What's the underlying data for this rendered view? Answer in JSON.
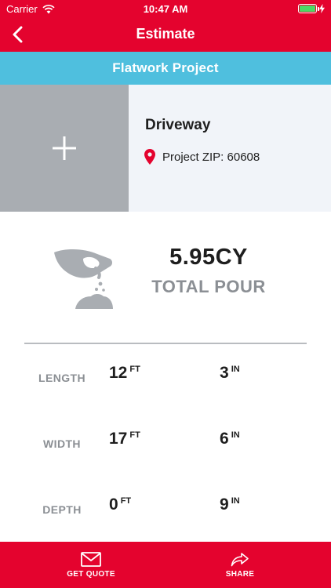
{
  "status_bar": {
    "carrier": "Carrier",
    "time": "10:47 AM",
    "battery_level": 1.0,
    "battery_color": "#4cd964"
  },
  "nav": {
    "title": "Estimate",
    "back_icon": "chevron-left-icon"
  },
  "project": {
    "type_label": "Flatwork Project",
    "name": "Driveway",
    "zip_text": "Project ZIP: 60608",
    "add_photo_icon": "plus-icon",
    "location_icon": "map-pin-icon"
  },
  "total": {
    "value": "5.95CY",
    "label": "TOTAL POUR",
    "icon": "concrete-pour-icon"
  },
  "dimensions": [
    {
      "label": "LENGTH",
      "feet": "12",
      "feet_unit": "FT",
      "inches": "3",
      "inches_unit": "IN"
    },
    {
      "label": "WIDTH",
      "feet": "17",
      "feet_unit": "FT",
      "inches": "6",
      "inches_unit": "IN"
    },
    {
      "label": "DEPTH",
      "feet": "0",
      "feet_unit": "FT",
      "inches": "9",
      "inches_unit": "IN"
    }
  ],
  "tabs": {
    "get_quote": {
      "label": "GET QUOTE",
      "icon": "envelope-icon"
    },
    "share": {
      "label": "SHARE",
      "icon": "share-arrow-icon"
    }
  },
  "colors": {
    "brand_red": "#e4032e",
    "banner_blue": "#4fbfde",
    "placeholder_gray": "#a9adb2",
    "muted_text": "#8b8f94"
  }
}
